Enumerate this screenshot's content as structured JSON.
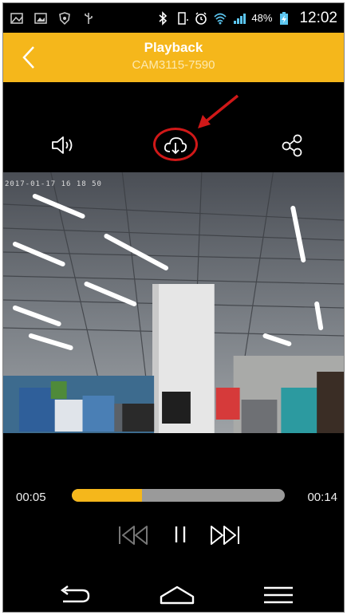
{
  "status_bar": {
    "icons": [
      "picture-icon",
      "gallery-icon",
      "shield-icon",
      "usb-icon",
      "bluetooth-icon",
      "vibrate-icon",
      "alarm-icon",
      "wifi-icon",
      "signal-icon",
      "battery-charging-icon"
    ],
    "battery": "48%",
    "time": "12:02"
  },
  "header": {
    "title": "Playback",
    "subtitle": "CAM3115-7590",
    "background": "#f5b71b"
  },
  "actions": {
    "icons": [
      "speaker-icon",
      "cloud-download-icon",
      "share-icon"
    ],
    "highlighted": "cloud-download-icon"
  },
  "video": {
    "timestamp": "2017-01-17 16 18 50"
  },
  "progress": {
    "current": "00:05",
    "total": "00:14",
    "fraction": 0.33
  },
  "playback_controls": [
    "previous-icon",
    "pause-icon",
    "next-icon"
  ],
  "nav_bar": [
    "back-icon",
    "home-icon",
    "menu-icon"
  ]
}
